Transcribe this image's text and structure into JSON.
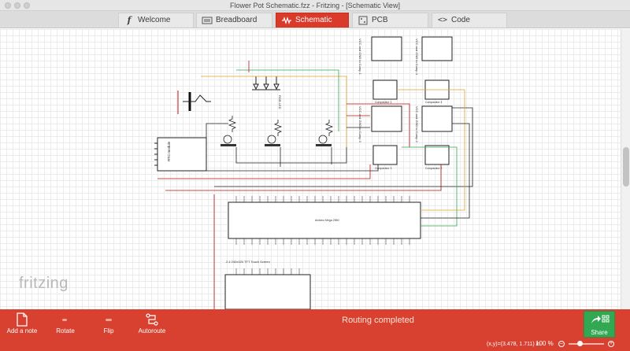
{
  "window": {
    "title": "Flower Pot Schematic.fzz - Fritzing - [Schematic View]"
  },
  "tabs": [
    {
      "label": "Welcome",
      "icon": "fritzing-f-icon"
    },
    {
      "label": "Breadboard",
      "icon": "breadboard-icon"
    },
    {
      "label": "Schematic",
      "icon": "schematic-icon"
    },
    {
      "label": "PCB",
      "icon": "pcb-icon"
    },
    {
      "label": "Code",
      "icon": "code-icon"
    }
  ],
  "canvas": {
    "brand": "fritzing",
    "labels": {
      "rgb_led": "RGB LED",
      "rtc_module": "RTC module",
      "tft": "2.4 240x320 TFT Touch Screen",
      "comp1": "Comparator 1",
      "comp2": "Comparator 2",
      "comp3": "Comparator 3",
      "comp4": "Comparator 4",
      "vcc1": "VCC and GND to Comp 1",
      "vcc2": "VCC and GND to Comp 2",
      "vcc3": "VCC and GND to Comp 3",
      "vcc4": "VCC and GND to Comp 4",
      "mega": "Arduino Mega 2560"
    }
  },
  "toolbar": {
    "add_note": "Add a note",
    "rotate": "Rotate",
    "flip": "Flip",
    "autoroute": "Autoroute",
    "status": "Routing completed",
    "share": "Share",
    "coords": "(x,y)=(3.478, 1.711) in",
    "zoom": "100 %"
  },
  "colors": {
    "accent": "#d8412f",
    "active_tab": "#d93a2a",
    "share": "#33a853"
  }
}
